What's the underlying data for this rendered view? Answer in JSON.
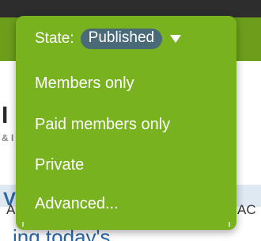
{
  "background": {
    "fragment_1": "I",
    "fragment_2": "& I",
    "fragment_3": "V",
    "fragment_4": "AR",
    "fragment_5": "AC",
    "fragment_6": "ing today's"
  },
  "dropdown": {
    "state_label": "State:",
    "state_value": "Published",
    "items": [
      {
        "label": "Members only"
      },
      {
        "label": "Paid members only"
      },
      {
        "label": "Private"
      },
      {
        "label": "Advanced..."
      }
    ]
  },
  "icons": {
    "caret": "caret-down-icon"
  },
  "colors": {
    "dropdown_bg": "#78b21f",
    "pill_bg": "#4a6a78",
    "text": "#ffffff"
  }
}
